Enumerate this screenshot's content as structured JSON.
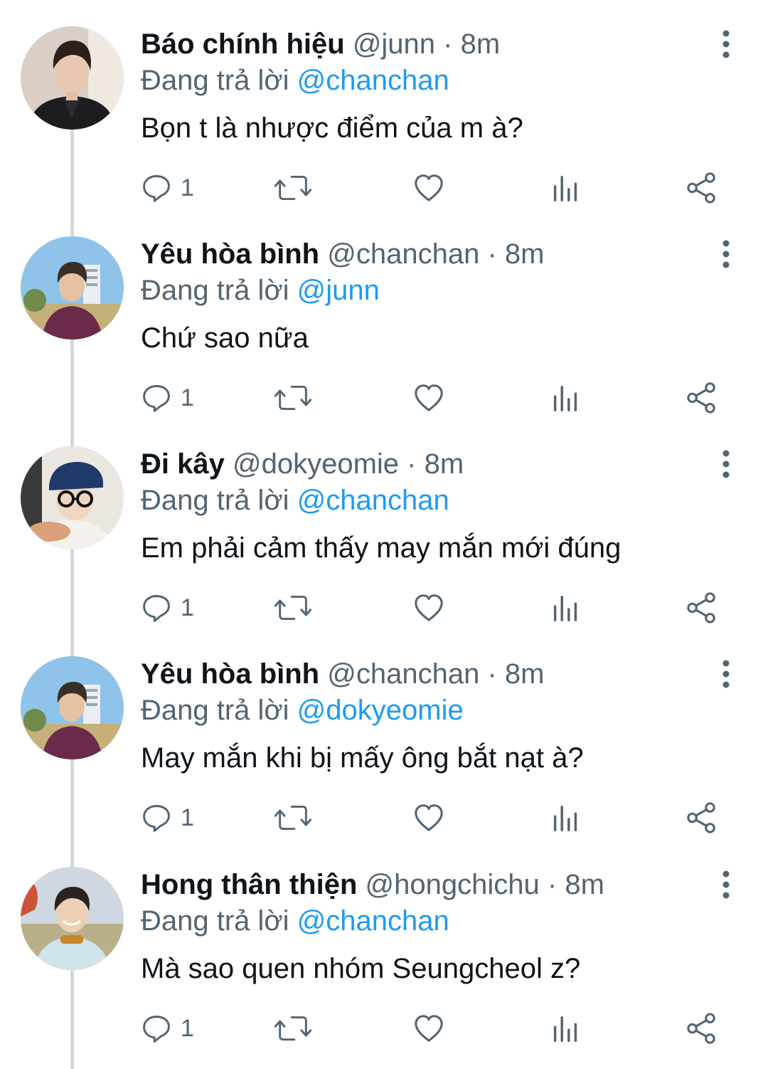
{
  "thread": {
    "tweets": [
      {
        "name": "Báo chính hiệu",
        "handle": "@junn",
        "separator": "·",
        "time": "8m",
        "replying_prefix": "Đang trả lời",
        "replying_to": "@chanchan",
        "text": "Bọn t là nhược điểm của m à?",
        "reply_count": "1",
        "avatar_icon": "avatar-dark-jacket-photo"
      },
      {
        "name": "Yêu hòa bình",
        "handle": "@chanchan",
        "separator": "·",
        "time": "8m",
        "replying_prefix": "Đang trả lời",
        "replying_to": "@junn",
        "text": "Chứ sao nữa",
        "reply_count": "1",
        "avatar_icon": "avatar-purple-hoodie-outdoor-photo"
      },
      {
        "name": "Đi kây",
        "handle": "@dokyeomie",
        "separator": "·",
        "time": "8m",
        "replying_prefix": "Đang trả lời",
        "replying_to": "@chanchan",
        "text": "Em phải cảm thấy may mắn mới đúng",
        "reply_count": "1",
        "avatar_icon": "avatar-blue-cap-glasses-photo"
      },
      {
        "name": "Yêu hòa bình",
        "handle": "@chanchan",
        "separator": "·",
        "time": "8m",
        "replying_prefix": "Đang trả lời",
        "replying_to": "@dokyeomie",
        "text": "May mắn khi bị mấy ông bắt nạt à?",
        "reply_count": "1",
        "avatar_icon": "avatar-purple-hoodie-outdoor-photo"
      },
      {
        "name": "Hong thân thiện",
        "handle": "@hongchichu",
        "separator": "·",
        "time": "8m",
        "replying_prefix": "Đang trả lời",
        "replying_to": "@chanchan",
        "text": "Mà sao quen nhóm Seungcheol z?",
        "reply_count": "1",
        "avatar_icon": "avatar-field-portrait-photo"
      }
    ]
  },
  "colors": {
    "name": "#0f1419",
    "secondary": "#536471",
    "mention": "#1d9bf0",
    "thread_line": "#cfd9de"
  },
  "icons": {
    "reply": "reply-icon",
    "retweet": "retweet-icon",
    "like": "heart-icon",
    "views": "views-icon",
    "share": "share-icon",
    "more": "more-vertical-icon"
  }
}
